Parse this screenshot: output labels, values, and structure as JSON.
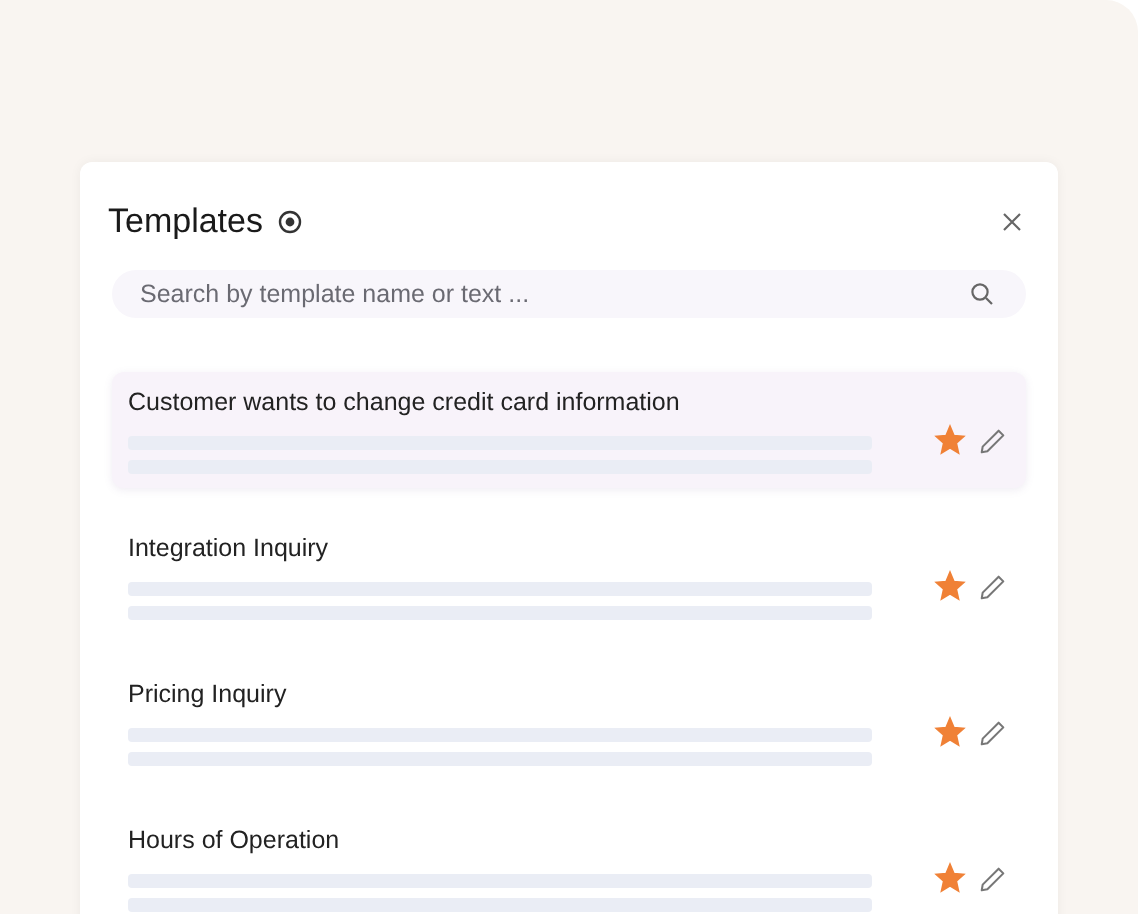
{
  "panel": {
    "title": "Templates",
    "search": {
      "placeholder": "Search by template name or text ..."
    },
    "templates": [
      {
        "name": "Customer wants to change credit card information",
        "selected": true,
        "starred": true
      },
      {
        "name": "Integration Inquiry",
        "selected": false,
        "starred": true
      },
      {
        "name": "Pricing Inquiry",
        "selected": false,
        "starred": true
      },
      {
        "name": "Hours of Operation",
        "selected": false,
        "starred": true
      }
    ]
  }
}
